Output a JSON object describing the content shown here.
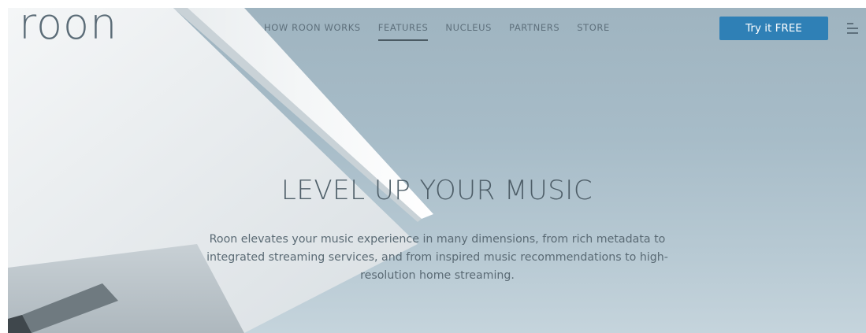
{
  "header": {
    "logo_text": "roon",
    "nav": [
      {
        "label": "HOW ROON WORKS",
        "active": false
      },
      {
        "label": "FEATURES",
        "active": true
      },
      {
        "label": "NUCLEUS",
        "active": false
      },
      {
        "label": "PARTNERS",
        "active": false
      },
      {
        "label": "STORE",
        "active": false
      }
    ],
    "cta_label": "Try it FREE",
    "menu_icon": "hamburger-menu-icon"
  },
  "hero": {
    "title": "LEVEL UP YOUR MUSIC",
    "subtitle": "Roon elevates your music experience in many dimensions, from rich metadata to integrated streaming services, and from inspired music recommendations to high-resolution home streaming."
  },
  "colors": {
    "sky": "#a7bcc8",
    "cta": "#2f80b6",
    "text": "#5a6a74"
  }
}
